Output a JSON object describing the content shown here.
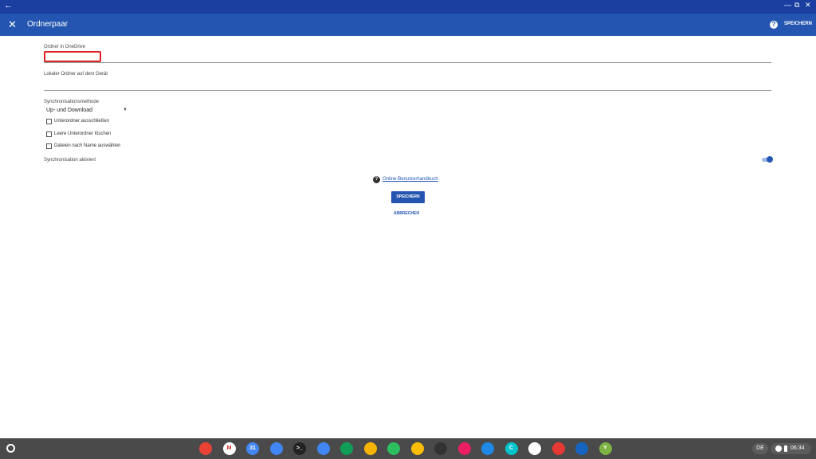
{
  "app": {
    "title": "Ordnerpaar",
    "save_label": "SPEICHERN"
  },
  "form": {
    "onedrive_label": "Ordner in OneDrive",
    "local_label": "Lokaler Ordner auf dem Gerät",
    "method_label": "Synchronisationsmethode",
    "method_value": "Up- und Download",
    "checkboxes": [
      {
        "label": "Unterordner ausschließen",
        "checked": false
      },
      {
        "label": "Leere Unterordner löschen",
        "checked": false
      },
      {
        "label": "Dateien nach Name auswählen",
        "checked": false
      }
    ],
    "sync_label": "Synchronisation aktiviert",
    "sync_enabled": true,
    "manual_link": "Online-Benutzerhandbuch",
    "save_button": "SPEICHERN",
    "cancel_button": "ABBRECHEN"
  },
  "shelf": {
    "ime": "DE",
    "time": "06:34",
    "apps": [
      {
        "name": "chrome-icon",
        "color": "#ea4335",
        "glyph": ""
      },
      {
        "name": "gmail-icon",
        "color": "#ffffff",
        "glyph": "M"
      },
      {
        "name": "calendar-icon",
        "color": "#4285f4",
        "glyph": "31"
      },
      {
        "name": "files-icon",
        "color": "#4285f4",
        "glyph": ""
      },
      {
        "name": "terminal-icon",
        "color": "#222222",
        "glyph": ">_"
      },
      {
        "name": "docs-icon",
        "color": "#4285f4",
        "glyph": ""
      },
      {
        "name": "sheets-icon",
        "color": "#0f9d58",
        "glyph": ""
      },
      {
        "name": "slides-icon",
        "color": "#f4b400",
        "glyph": ""
      },
      {
        "name": "evernote-icon",
        "color": "#2dbe60",
        "glyph": ""
      },
      {
        "name": "keep-icon",
        "color": "#fbbc04",
        "glyph": ""
      },
      {
        "name": "app-icon",
        "color": "#333333",
        "glyph": ""
      },
      {
        "name": "app-icon",
        "color": "#e91e63",
        "glyph": ""
      },
      {
        "name": "app-icon",
        "color": "#1e88e5",
        "glyph": ""
      },
      {
        "name": "canva-icon",
        "color": "#00c4cc",
        "glyph": "C"
      },
      {
        "name": "play-store-icon",
        "color": "#ffffff",
        "glyph": ""
      },
      {
        "name": "app-icon",
        "color": "#e53935",
        "glyph": ""
      },
      {
        "name": "onedrive-sync-icon",
        "color": "#1565c0",
        "glyph": ""
      },
      {
        "name": "app-icon",
        "color": "#7cb342",
        "glyph": "Y"
      }
    ]
  }
}
